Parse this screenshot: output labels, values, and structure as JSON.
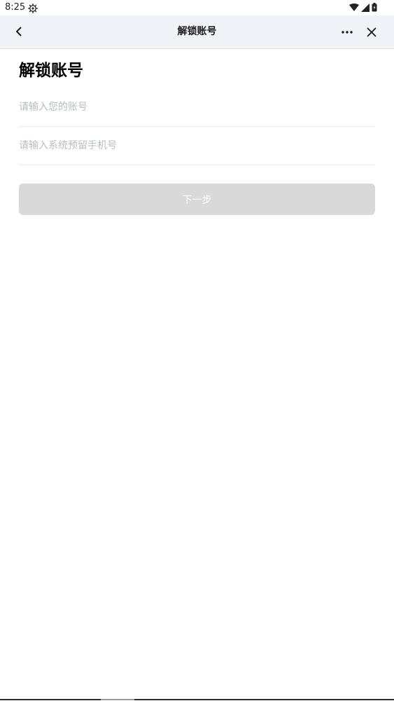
{
  "status_bar": {
    "time": "8:25",
    "icons": [
      "gear-icon",
      "wifi-icon",
      "signal-icon",
      "battery-icon"
    ]
  },
  "nav_bar": {
    "title": "解锁账号",
    "icons": [
      "back-chevron-icon",
      "more-icon",
      "close-icon"
    ]
  },
  "form": {
    "title": "解锁账号",
    "account_placeholder": "请输入您的账号",
    "account_value": "",
    "phone_placeholder": "请输入系统预留手机号",
    "phone_value": "",
    "next_label": "下一步"
  },
  "colors": {
    "nav_background": "#f2f3f8",
    "button_disabled": "#d9d9d9",
    "placeholder": "#b8bcc4"
  }
}
